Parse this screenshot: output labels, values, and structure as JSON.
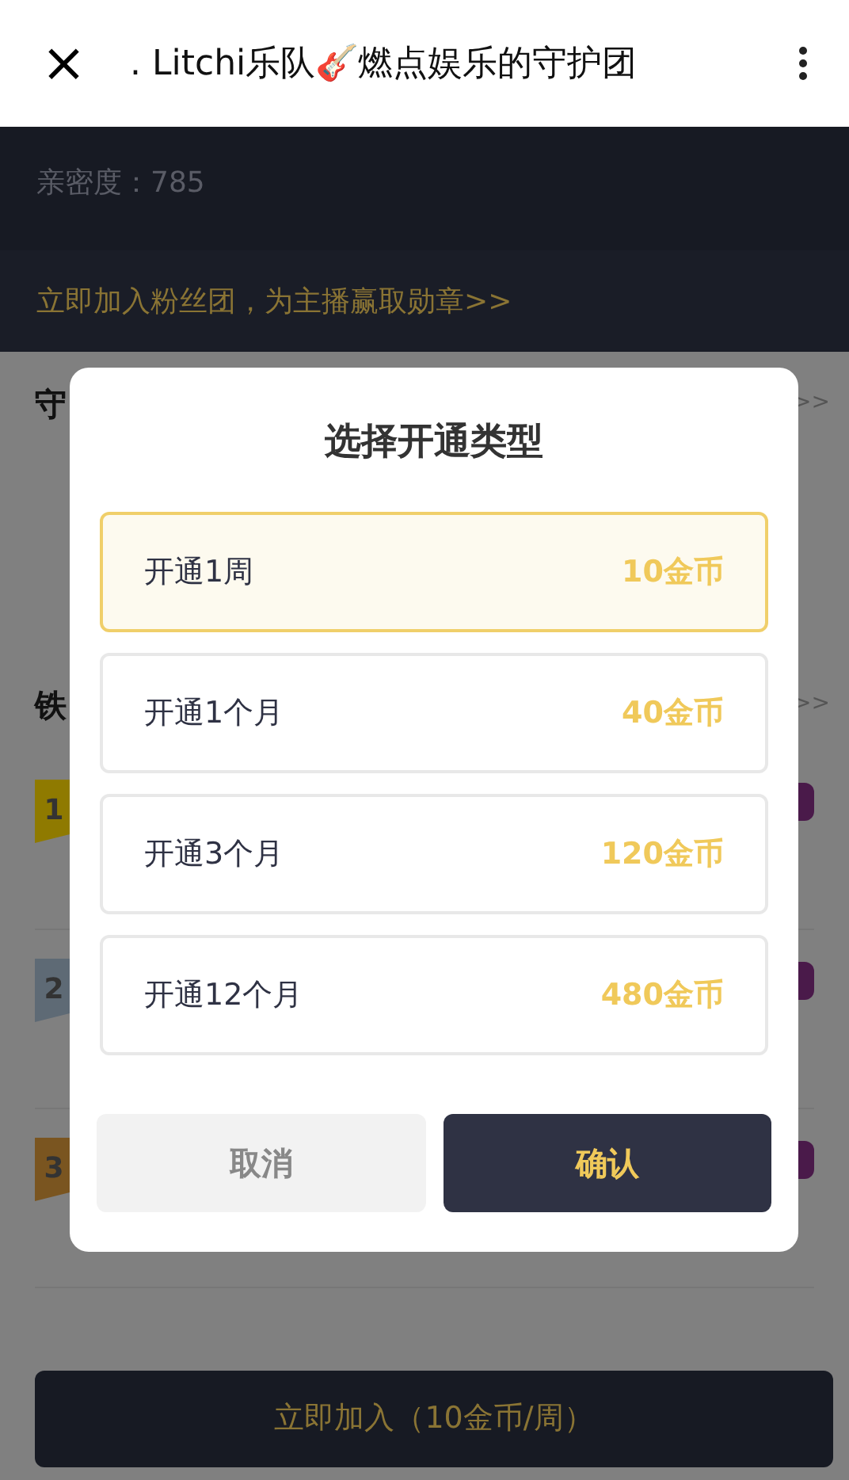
{
  "header": {
    "close": "×",
    "title": ". Litchi乐队🎸燃点娱乐的守护团"
  },
  "intimacy": "亲密度：785",
  "join_link": "立即加入粉丝团，为主播赢取勋章>>",
  "sections": [
    {
      "title": "守",
      "more": ">>"
    },
    {
      "title": "铁",
      "more": ">>"
    }
  ],
  "ranks": [
    {
      "rank": "1",
      "color": "#8f7a00"
    },
    {
      "rank": "2",
      "color": "#5e6a75"
    },
    {
      "rank": "3",
      "color": "#7a5520"
    }
  ],
  "dialog": {
    "title": "选择开通类型",
    "options": [
      {
        "label": "开通1周",
        "price": "10金币",
        "selected": true
      },
      {
        "label": "开通1个月",
        "price": "40金币",
        "selected": false
      },
      {
        "label": "开通3个月",
        "price": "120金币",
        "selected": false
      },
      {
        "label": "开通12个月",
        "price": "480金币",
        "selected": false
      }
    ],
    "cancel": "取消",
    "confirm": "确认"
  },
  "join_button": "立即加入（10金币/周）"
}
